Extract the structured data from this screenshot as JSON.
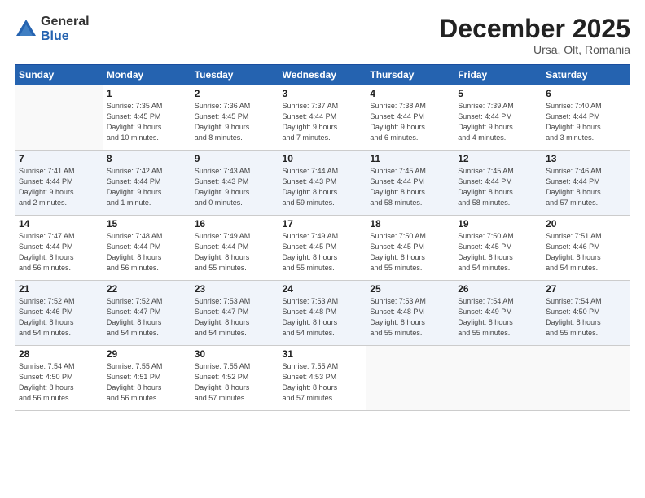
{
  "logo": {
    "general": "General",
    "blue": "Blue"
  },
  "title": "December 2025",
  "subtitle": "Ursa, Olt, Romania",
  "headers": [
    "Sunday",
    "Monday",
    "Tuesday",
    "Wednesday",
    "Thursday",
    "Friday",
    "Saturday"
  ],
  "weeks": [
    [
      {
        "day": "",
        "info": ""
      },
      {
        "day": "1",
        "info": "Sunrise: 7:35 AM\nSunset: 4:45 PM\nDaylight: 9 hours\nand 10 minutes."
      },
      {
        "day": "2",
        "info": "Sunrise: 7:36 AM\nSunset: 4:45 PM\nDaylight: 9 hours\nand 8 minutes."
      },
      {
        "day": "3",
        "info": "Sunrise: 7:37 AM\nSunset: 4:44 PM\nDaylight: 9 hours\nand 7 minutes."
      },
      {
        "day": "4",
        "info": "Sunrise: 7:38 AM\nSunset: 4:44 PM\nDaylight: 9 hours\nand 6 minutes."
      },
      {
        "day": "5",
        "info": "Sunrise: 7:39 AM\nSunset: 4:44 PM\nDaylight: 9 hours\nand 4 minutes."
      },
      {
        "day": "6",
        "info": "Sunrise: 7:40 AM\nSunset: 4:44 PM\nDaylight: 9 hours\nand 3 minutes."
      }
    ],
    [
      {
        "day": "7",
        "info": "Sunrise: 7:41 AM\nSunset: 4:44 PM\nDaylight: 9 hours\nand 2 minutes."
      },
      {
        "day": "8",
        "info": "Sunrise: 7:42 AM\nSunset: 4:44 PM\nDaylight: 9 hours\nand 1 minute."
      },
      {
        "day": "9",
        "info": "Sunrise: 7:43 AM\nSunset: 4:43 PM\nDaylight: 9 hours\nand 0 minutes."
      },
      {
        "day": "10",
        "info": "Sunrise: 7:44 AM\nSunset: 4:43 PM\nDaylight: 8 hours\nand 59 minutes."
      },
      {
        "day": "11",
        "info": "Sunrise: 7:45 AM\nSunset: 4:44 PM\nDaylight: 8 hours\nand 58 minutes."
      },
      {
        "day": "12",
        "info": "Sunrise: 7:45 AM\nSunset: 4:44 PM\nDaylight: 8 hours\nand 58 minutes."
      },
      {
        "day": "13",
        "info": "Sunrise: 7:46 AM\nSunset: 4:44 PM\nDaylight: 8 hours\nand 57 minutes."
      }
    ],
    [
      {
        "day": "14",
        "info": "Sunrise: 7:47 AM\nSunset: 4:44 PM\nDaylight: 8 hours\nand 56 minutes."
      },
      {
        "day": "15",
        "info": "Sunrise: 7:48 AM\nSunset: 4:44 PM\nDaylight: 8 hours\nand 56 minutes."
      },
      {
        "day": "16",
        "info": "Sunrise: 7:49 AM\nSunset: 4:44 PM\nDaylight: 8 hours\nand 55 minutes."
      },
      {
        "day": "17",
        "info": "Sunrise: 7:49 AM\nSunset: 4:45 PM\nDaylight: 8 hours\nand 55 minutes."
      },
      {
        "day": "18",
        "info": "Sunrise: 7:50 AM\nSunset: 4:45 PM\nDaylight: 8 hours\nand 55 minutes."
      },
      {
        "day": "19",
        "info": "Sunrise: 7:50 AM\nSunset: 4:45 PM\nDaylight: 8 hours\nand 54 minutes."
      },
      {
        "day": "20",
        "info": "Sunrise: 7:51 AM\nSunset: 4:46 PM\nDaylight: 8 hours\nand 54 minutes."
      }
    ],
    [
      {
        "day": "21",
        "info": "Sunrise: 7:52 AM\nSunset: 4:46 PM\nDaylight: 8 hours\nand 54 minutes."
      },
      {
        "day": "22",
        "info": "Sunrise: 7:52 AM\nSunset: 4:47 PM\nDaylight: 8 hours\nand 54 minutes."
      },
      {
        "day": "23",
        "info": "Sunrise: 7:53 AM\nSunset: 4:47 PM\nDaylight: 8 hours\nand 54 minutes."
      },
      {
        "day": "24",
        "info": "Sunrise: 7:53 AM\nSunset: 4:48 PM\nDaylight: 8 hours\nand 54 minutes."
      },
      {
        "day": "25",
        "info": "Sunrise: 7:53 AM\nSunset: 4:48 PM\nDaylight: 8 hours\nand 55 minutes."
      },
      {
        "day": "26",
        "info": "Sunrise: 7:54 AM\nSunset: 4:49 PM\nDaylight: 8 hours\nand 55 minutes."
      },
      {
        "day": "27",
        "info": "Sunrise: 7:54 AM\nSunset: 4:50 PM\nDaylight: 8 hours\nand 55 minutes."
      }
    ],
    [
      {
        "day": "28",
        "info": "Sunrise: 7:54 AM\nSunset: 4:50 PM\nDaylight: 8 hours\nand 56 minutes."
      },
      {
        "day": "29",
        "info": "Sunrise: 7:55 AM\nSunset: 4:51 PM\nDaylight: 8 hours\nand 56 minutes."
      },
      {
        "day": "30",
        "info": "Sunrise: 7:55 AM\nSunset: 4:52 PM\nDaylight: 8 hours\nand 57 minutes."
      },
      {
        "day": "31",
        "info": "Sunrise: 7:55 AM\nSunset: 4:53 PM\nDaylight: 8 hours\nand 57 minutes."
      },
      {
        "day": "",
        "info": ""
      },
      {
        "day": "",
        "info": ""
      },
      {
        "day": "",
        "info": ""
      }
    ]
  ]
}
